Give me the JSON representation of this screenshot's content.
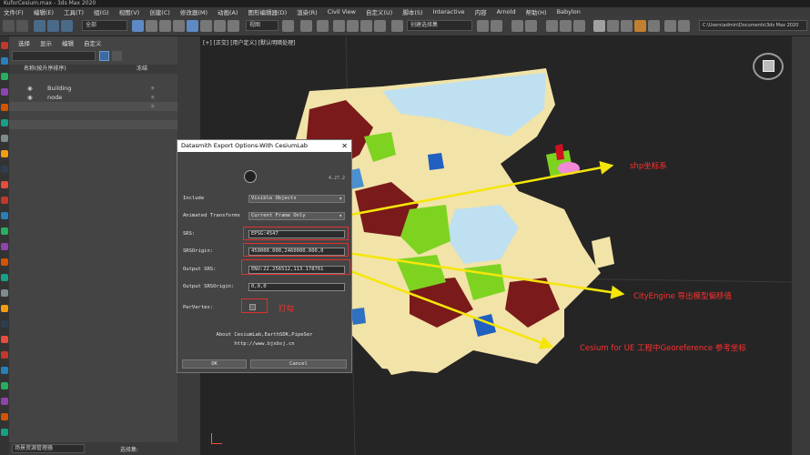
{
  "window": {
    "title": "KuforCesium.max - 3ds Max 2020"
  },
  "menu": [
    "文件(F)",
    "编辑(E)",
    "工具(T)",
    "组(G)",
    "视图(V)",
    "创建(C)",
    "修改器(M)",
    "动画(A)",
    "图形编辑器(D)",
    "渲染(R)",
    "Civil View",
    "自定义(U)",
    "脚本(S)",
    "Interactive",
    "内容",
    "Arnold",
    "帮助(H)",
    "Babylon"
  ],
  "toolbar": {
    "selection_filter": "全部",
    "ref_coord": "视图",
    "named_selection": "创建选择集",
    "project_path": "C:\\Users\\admin\\Documents\\3ds Max 2020"
  },
  "scene_explorer": {
    "tabs": [
      "选择",
      "显示",
      "编辑",
      "自定义"
    ],
    "columns": {
      "name": "名称(按升序排序)",
      "frozen": "冻结"
    },
    "items": [
      "Building",
      "node"
    ],
    "footer": {
      "explorer": "场景资源管理器",
      "selection": "选择集:"
    }
  },
  "viewport": {
    "label": "[+] [正交] [用户定义] [默认明暗处理]"
  },
  "dialog": {
    "title": "Datasmith Export Options-With CesiumLab",
    "version": "4.27.2",
    "fields": {
      "include": {
        "label": "Include",
        "value": "Visible Objects"
      },
      "animated": {
        "label": "Animated Transforms",
        "value": "Current Frame Only"
      },
      "srs": {
        "label": "SRS:",
        "value": "EPSG:4547"
      },
      "srs_origin": {
        "label": "SRSOrigin:",
        "value": "450000.000,2460000.000,0"
      },
      "output_srs": {
        "label": "Output SRS:",
        "value": "ENU:22.256512,113.178761"
      },
      "output_srs_origin": {
        "label": "Output SRSOrigin:",
        "value": "0,0,0"
      },
      "per_vertex": {
        "label": "PerVertex:"
      }
    },
    "about": "About CesiumLab,EarthSDK,PipeSer",
    "url": "http://www.bjxbsj.cn",
    "ok": "OK",
    "cancel": "Cancel"
  },
  "annotations": {
    "shp": "shp坐标系",
    "check": "打勾",
    "cityengine": "CityEngine 导出模型偏移值",
    "cesium": "Cesium for UE 工程中Georeference 参考坐标"
  },
  "colors": {
    "annotation": "#ff3030",
    "arrow": "#f5e60a",
    "water": "#bfe0f0",
    "building": "#7a1a1a",
    "green": "#7ed321",
    "parcel": "#f2e3a8"
  }
}
